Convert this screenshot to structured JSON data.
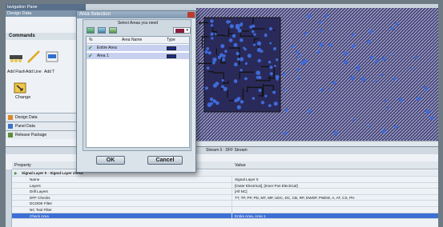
{
  "nav": {
    "title": "lavigation Pane",
    "subtitle": "Design Data",
    "commands_label": "Commands",
    "commands": [
      "Add Flash",
      "Add Line",
      "Add T"
    ],
    "change_label": "Change",
    "menu": [
      "Design Data",
      "Panel Data",
      "Release Package"
    ]
  },
  "dialog": {
    "title": "Area Selection",
    "prompt": "Select Areas you need",
    "columns": {
      "check": "%",
      "name": "Area Name",
      "type": "Type"
    },
    "areas": [
      {
        "name": "Entire Area"
      },
      {
        "name": "Area 1"
      }
    ],
    "ok_label": "OK",
    "cancel_label": "Cancel",
    "colors": {
      "accent": "#1b2c8c",
      "check": "#2a8a2a"
    }
  },
  "lower": {
    "title": "Stream 0 : DFF Stream",
    "columns": {
      "property": "Property",
      "value": "Value"
    },
    "group": "Signal Layer 0 - Signal Layer check",
    "rows": [
      {
        "k": "Name",
        "v": "Signal Layer 0"
      },
      {
        "k": "Layers",
        "v": "[Outer Electrical], [Inner Pos Electrical]"
      },
      {
        "k": "Drill Layers",
        "v": "[All NC]"
      },
      {
        "k": "DFF Checks",
        "v": "TT, TP, PP, PD, MT, MP, UDC, DC, CB, RP, DWDP, PWDD, A, AT, CS, PH"
      },
      {
        "k": "DCODE Filter",
        "v": ""
      },
      {
        "k": "NC Tool Filter",
        "v": ""
      },
      {
        "k": "Check Area",
        "v": "Entire Area, Area 1"
      }
    ]
  },
  "colors": {
    "pcb_bg": "#3c3c70",
    "pad": "#3f6bd8",
    "trace": "#1a1a1a"
  }
}
